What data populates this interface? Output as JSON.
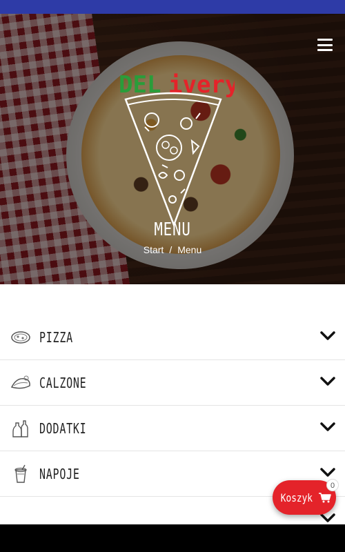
{
  "brand": {
    "logo_text": "DELivery",
    "colors": {
      "status_bar": "#2e3ba7",
      "accent": "#e4232a",
      "logo_green": "#2a9d3a",
      "logo_red": "#e4232a"
    }
  },
  "hero": {
    "title": "MENU",
    "breadcrumb": {
      "home": "Start",
      "separator": "/",
      "current": "Menu"
    }
  },
  "header": {
    "menu_icon": "hamburger-icon"
  },
  "categories": [
    {
      "label": "PIZZA",
      "icon": "pizza-icon"
    },
    {
      "label": "CALZONE",
      "icon": "calzone-icon"
    },
    {
      "label": "DODATKI",
      "icon": "bottles-icon"
    },
    {
      "label": "NAPOJE",
      "icon": "drink-cup-icon"
    },
    {
      "label": "",
      "icon": ""
    }
  ],
  "cart": {
    "label": "Koszyk",
    "count": "0",
    "icon": "cart-icon"
  }
}
